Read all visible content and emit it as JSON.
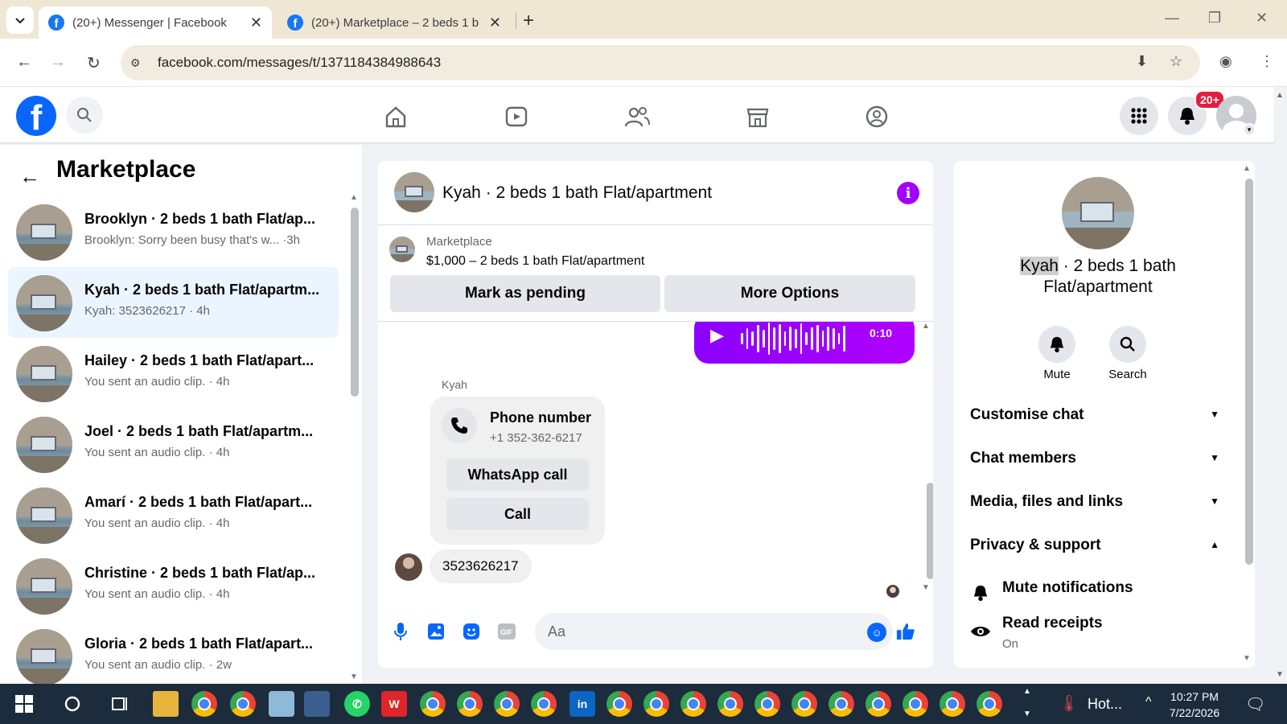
{
  "browser": {
    "tabs": [
      {
        "title": "(20+) Messenger | Facebook",
        "active": true
      },
      {
        "title": "(20+) Marketplace – 2 beds 1 b",
        "active": false
      }
    ],
    "new_tab": "+",
    "url": "facebook.com/messages/t/1371184384988643"
  },
  "fb_header": {
    "logo_letter": "f",
    "notification_badge": "20+"
  },
  "left_pane": {
    "title": "Marketplace",
    "conversations": [
      {
        "name": "Brooklyn · 2 beds 1 bath Flat/ap...",
        "preview": "Brooklyn: Sorry been busy that's w...  ·3h",
        "selected": false
      },
      {
        "name": "Kyah · 2 beds 1 bath Flat/apartm...",
        "preview": "Kyah: 3523626217 · 4h",
        "selected": true
      },
      {
        "name": "Hailey · 2 beds 1 bath Flat/apart...",
        "preview": "You sent an audio clip. · 4h",
        "selected": false
      },
      {
        "name": "Joel · 2 beds 1 bath Flat/apartm...",
        "preview": "You sent an audio clip. · 4h",
        "selected": false
      },
      {
        "name": "Amarí · 2 beds 1 bath Flat/apart...",
        "preview": "You sent an audio clip. · 4h",
        "selected": false
      },
      {
        "name": "Christine · 2 beds 1 bath Flat/ap...",
        "preview": "You sent an audio clip. · 4h",
        "selected": false
      },
      {
        "name": "Gloria · 2 beds 1 bath Flat/apart...",
        "preview": "You sent an audio clip. · 2w",
        "selected": false
      }
    ]
  },
  "chat": {
    "title": "Kyah · 2 beds 1 bath Flat/apartment",
    "marketplace_label": "Marketplace",
    "listing": "$1,000 – 2 beds 1 bath Flat/apartment",
    "mark_pending": "Mark as pending",
    "more_options": "More Options",
    "audio_duration": "0:10",
    "sender": "Kyah",
    "phone_card": {
      "title": "Phone number",
      "number": "+1 352-362-6217",
      "whatsapp": "WhatsApp call",
      "call": "Call"
    },
    "number_message": "3523626217",
    "composer_placeholder": "Aa"
  },
  "right_pane": {
    "name_highlight": "Kyah",
    "name_rest": " · 2 beds 1 bath Flat/apartment",
    "mute": "Mute",
    "search": "Search",
    "sections": [
      {
        "label": "Customise chat",
        "expanded": false
      },
      {
        "label": "Chat members",
        "expanded": false
      },
      {
        "label": "Media, files and links",
        "expanded": false
      },
      {
        "label": "Privacy & support",
        "expanded": true
      }
    ],
    "mute_notifications": "Mute notifications",
    "read_receipts": "Read receipts",
    "read_receipts_state": "On"
  },
  "taskbar": {
    "weather": "Hot...",
    "time": "10:27 PM",
    "date": "7/22/2026"
  },
  "colors": {
    "fb_blue": "#0866ff",
    "messenger_purple": "#a100ff",
    "selected_conv": "#ebf5ff",
    "badge_red": "#e41e3f"
  }
}
